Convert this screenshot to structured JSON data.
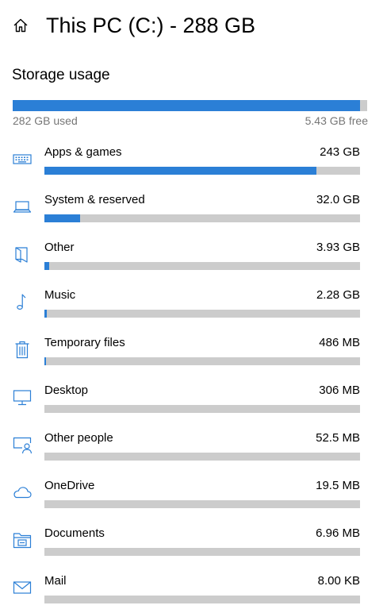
{
  "header": {
    "title": "This PC (C:) - 288 GB",
    "home_icon": "home-icon"
  },
  "storage": {
    "section_title": "Storage usage",
    "used_label": "282 GB used",
    "free_label": "5.43 GB free",
    "used_fraction": 0.98
  },
  "colors": {
    "accent": "#2b7fd6",
    "track": "#cccccc",
    "secondary_text": "#767676"
  },
  "categories": [
    {
      "label": "Apps & games",
      "size": "243 GB",
      "fraction": 0.862,
      "icon": "keyboard-icon"
    },
    {
      "label": "System & reserved",
      "size": "32.0 GB",
      "fraction": 0.113,
      "icon": "laptop-icon"
    },
    {
      "label": "Other",
      "size": "3.93 GB",
      "fraction": 0.014,
      "icon": "folder-open-icon"
    },
    {
      "label": "Music",
      "size": "2.28 GB",
      "fraction": 0.008,
      "icon": "music-note-icon"
    },
    {
      "label": "Temporary files",
      "size": "486 MB",
      "fraction": 0.002,
      "icon": "trash-icon"
    },
    {
      "label": "Desktop",
      "size": "306 MB",
      "fraction": 0.0,
      "icon": "monitor-icon"
    },
    {
      "label": "Other people",
      "size": "52.5 MB",
      "fraction": 0.0,
      "icon": "other-people-icon"
    },
    {
      "label": "OneDrive",
      "size": "19.5 MB",
      "fraction": 0.0,
      "icon": "cloud-icon"
    },
    {
      "label": "Documents",
      "size": "6.96 MB",
      "fraction": 0.0,
      "icon": "documents-folder-icon"
    },
    {
      "label": "Mail",
      "size": "8.00 KB",
      "fraction": 0.0,
      "icon": "mail-icon"
    }
  ]
}
